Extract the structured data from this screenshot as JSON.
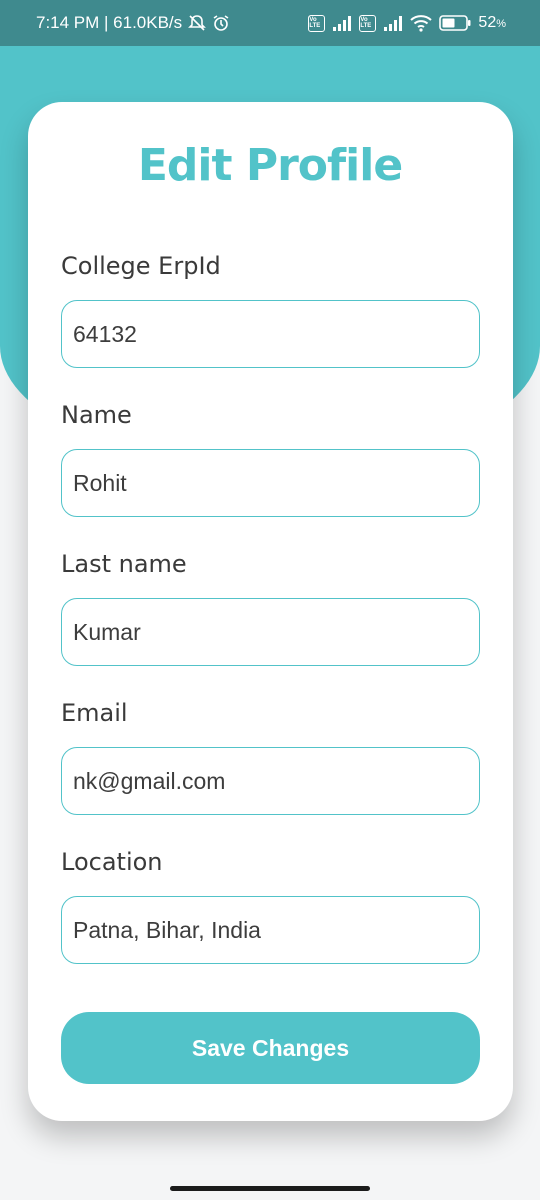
{
  "status_bar": {
    "time_speed": "7:14 PM | 61.0KB/s",
    "battery_percent": "52",
    "battery_suffix": "%",
    "volte_label": "Vo LTE",
    "icons": [
      "mute-bell-icon",
      "alarm-icon",
      "volte-icon",
      "signal-icon",
      "wifi-icon",
      "battery-icon"
    ]
  },
  "form": {
    "title": "Edit Profile",
    "fields": [
      {
        "label": "College ErpId",
        "value": "64132"
      },
      {
        "label": "Name",
        "value": "Rohit"
      },
      {
        "label": "Last name",
        "value": "Kumar"
      },
      {
        "label": "Email",
        "value": "nk@gmail.com"
      },
      {
        "label": "Location",
        "value": "Patna, Bihar, India"
      }
    ],
    "save_label": "Save Changes"
  },
  "colors": {
    "accent": "#52c3c9",
    "status_bar": "#3f8a8e",
    "card": "#ffffff",
    "label_text": "#3a3a3a"
  }
}
